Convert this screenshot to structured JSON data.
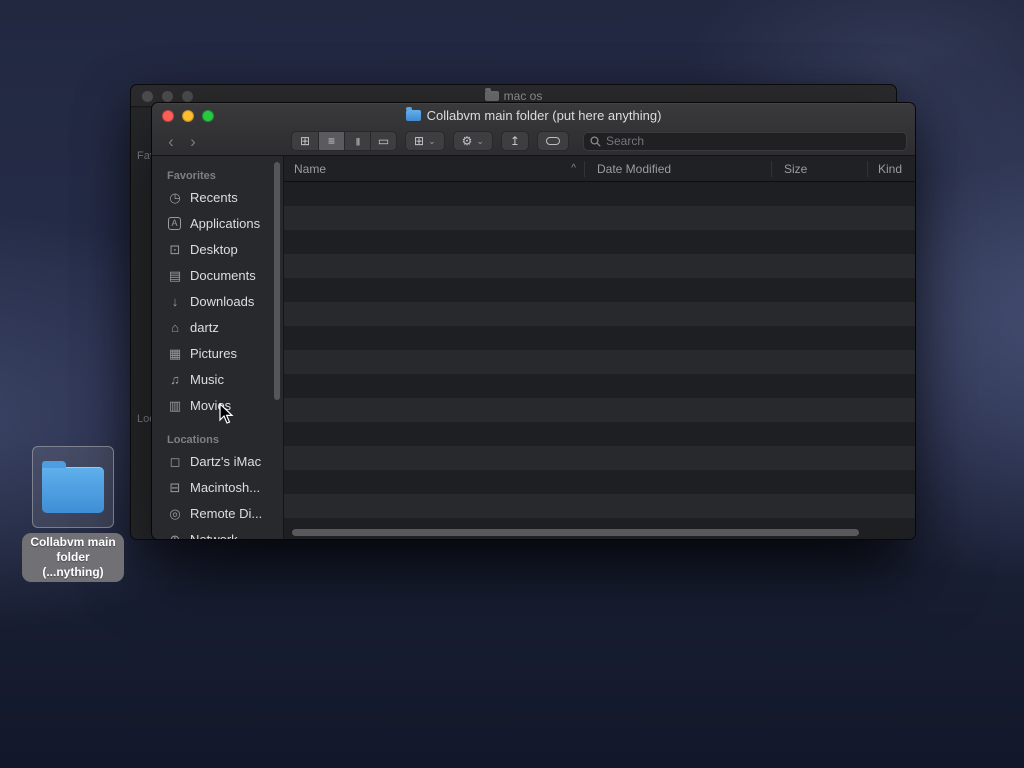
{
  "back_window": {
    "title": "mac os",
    "favorites_label": "Favorites",
    "locations_label": "Locations"
  },
  "finder": {
    "title": "Collabvm main folder (put here anything)",
    "toolbar": {
      "search_placeholder": "Search"
    },
    "icons": {
      "back": "‹",
      "forward": "›",
      "view_icons": "⊞",
      "view_list": "≡",
      "view_columns": "|||",
      "view_gallery": "▭",
      "group": "⊞",
      "gear": "⚙",
      "share": "↥",
      "chevron_down": "⌄",
      "sort_asc": "^",
      "recents": "◷",
      "applications": "A",
      "desktop": "⊡",
      "documents": "▤",
      "downloads": "↓",
      "home": "⌂",
      "pictures": "▦",
      "music": "♫",
      "movies": "▥",
      "imac": "◻",
      "disk": "⊟",
      "disc": "◎",
      "network": "⊕"
    },
    "sidebar": {
      "favorites_header": "Favorites",
      "favorites": [
        "Recents",
        "Applications",
        "Desktop",
        "Documents",
        "Downloads",
        "dartz",
        "Pictures",
        "Music",
        "Movies"
      ],
      "locations_header": "Locations",
      "locations": [
        "Dartz's iMac",
        "Macintosh...",
        "Remote Di...",
        "Network"
      ]
    },
    "columns": {
      "name": "Name",
      "date_modified": "Date Modified",
      "size": "Size",
      "kind": "Kind"
    }
  },
  "desktop_icon": {
    "line1": "Collabvm main",
    "line2": "folder (...nything)"
  },
  "colors": {
    "traffic_red": "#ff5f57",
    "traffic_yellow": "#febc2e",
    "traffic_green": "#28c840",
    "folder_blue": "#4d9fe0",
    "wallpaper_base": "#222840"
  }
}
